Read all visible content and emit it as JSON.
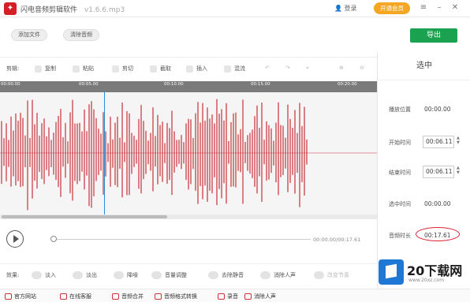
{
  "app": {
    "title": "闪电音频剪辑软件",
    "file": "v1.6.6.mp3",
    "login": "登录",
    "vip": "开通会员"
  },
  "actions": {
    "add_file": "添加文件",
    "clear_audio": "清除音频",
    "export": "导出"
  },
  "edit": {
    "label": "剪辑:",
    "tools": [
      "复制",
      "粘贴",
      "剪切",
      "截取",
      "插入",
      "混流"
    ]
  },
  "ruler": {
    "ticks": [
      "00:00.00",
      "00:05.00",
      "00:10.00",
      "00:15.00",
      "00:20.00"
    ]
  },
  "player": {
    "time": "00:00.00/00:17.61"
  },
  "effects": {
    "label": "效果:",
    "items": [
      "淡入",
      "淡出",
      "降噪",
      "音量调整",
      "去除静音",
      "消除人声",
      "改变节奏"
    ]
  },
  "bottom_links": [
    "官方网站",
    "在线客服",
    "音频合并",
    "音频格式转换",
    "录音",
    "消除人声"
  ],
  "panel": {
    "title": "选中",
    "play_position_label": "播放位置",
    "play_position": "00:00.00",
    "start_label": "开始时间",
    "start": "00:06.11",
    "end_label": "结束时间",
    "end": "00:06.11",
    "selected_label": "选中时间",
    "selected": "00:00.00",
    "total_label": "音频时长",
    "total": "00:17.61"
  },
  "watermark": {
    "text": "20下载网",
    "url": "www.20xz.com"
  },
  "colors": {
    "brand_red": "#d41f26",
    "export_green": "#1aa251",
    "wave": "#c8303a",
    "playhead": "#2b8fd6"
  }
}
